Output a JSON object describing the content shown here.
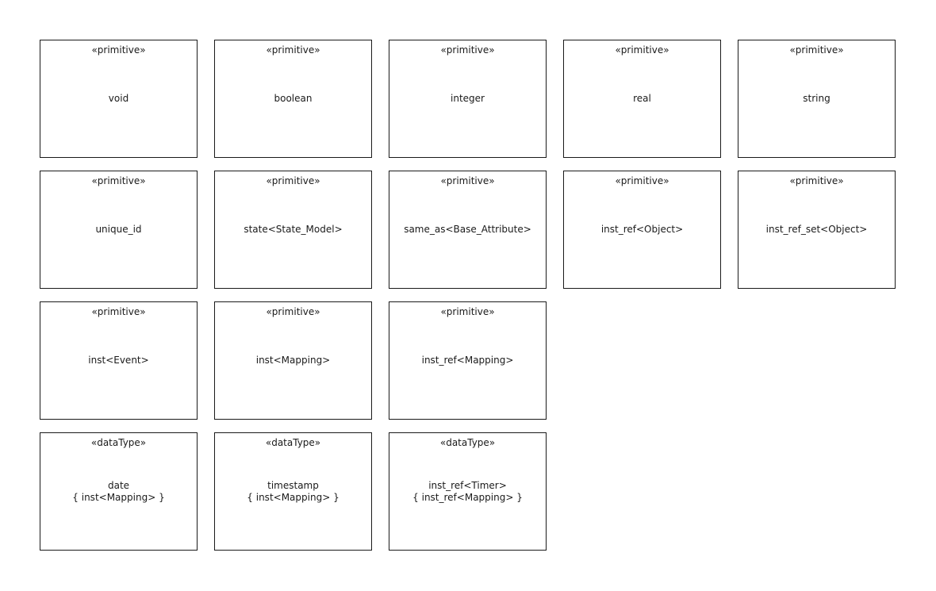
{
  "classifiers": [
    {
      "stereotype": "«primitive»",
      "name": "void",
      "constraint": ""
    },
    {
      "stereotype": "«primitive»",
      "name": "boolean",
      "constraint": ""
    },
    {
      "stereotype": "«primitive»",
      "name": "integer",
      "constraint": ""
    },
    {
      "stereotype": "«primitive»",
      "name": "real",
      "constraint": ""
    },
    {
      "stereotype": "«primitive»",
      "name": "string",
      "constraint": ""
    },
    {
      "stereotype": "«primitive»",
      "name": "unique_id",
      "constraint": ""
    },
    {
      "stereotype": "«primitive»",
      "name": "state<State_Model>",
      "constraint": ""
    },
    {
      "stereotype": "«primitive»",
      "name": "same_as<Base_Attribute>",
      "constraint": ""
    },
    {
      "stereotype": "«primitive»",
      "name": "inst_ref<Object>",
      "constraint": ""
    },
    {
      "stereotype": "«primitive»",
      "name": "inst_ref_set<Object>",
      "constraint": ""
    },
    {
      "stereotype": "«primitive»",
      "name": "inst<Event>",
      "constraint": ""
    },
    {
      "stereotype": "«primitive»",
      "name": "inst<Mapping>",
      "constraint": ""
    },
    {
      "stereotype": "«primitive»",
      "name": "inst_ref<Mapping>",
      "constraint": ""
    },
    {
      "stereotype": "«dataType»",
      "name": "date",
      "constraint": "{ inst<Mapping> }"
    },
    {
      "stereotype": "«dataType»",
      "name": "timestamp",
      "constraint": "{ inst<Mapping> }"
    },
    {
      "stereotype": "«dataType»",
      "name": "inst_ref<Timer>",
      "constraint": "{ inst_ref<Mapping> }"
    }
  ]
}
